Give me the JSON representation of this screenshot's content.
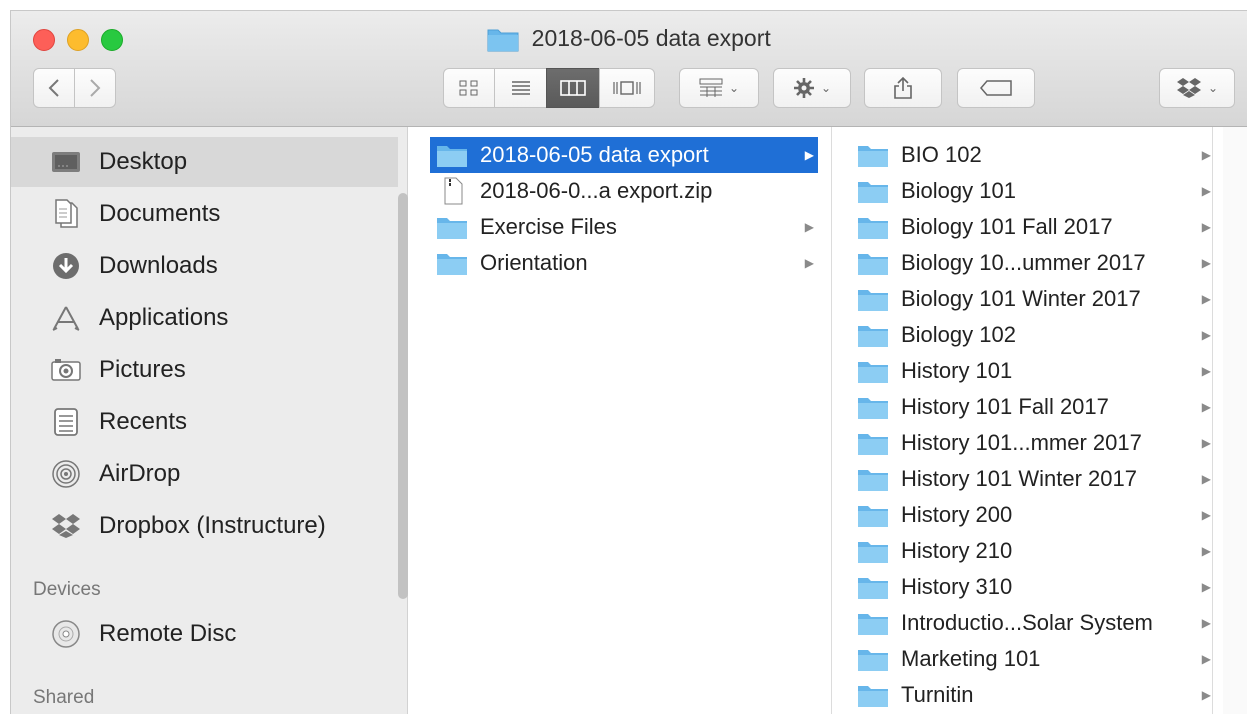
{
  "window": {
    "title": "2018-06-05 data export"
  },
  "toolbar": {
    "back_icon": "chevron-left-icon",
    "forward_icon": "chevron-right-icon",
    "view_buttons": [
      "icon-view-icon",
      "list-view-icon",
      "column-view-icon",
      "cover-flow-icon"
    ],
    "active_view": "column-view",
    "arrange_icon": "arrange-grid-icon",
    "action_icon": "gear-icon",
    "share_icon": "share-icon",
    "tag_icon": "tag-icon",
    "dropbox_icon": "dropbox-icon",
    "caret": "⌄"
  },
  "sidebar": {
    "favorites": [
      {
        "label": "Desktop",
        "icon": "desktop-icon",
        "selected": true
      },
      {
        "label": "Documents",
        "icon": "documents-icon"
      },
      {
        "label": "Downloads",
        "icon": "downloads-icon"
      },
      {
        "label": "Applications",
        "icon": "applications-icon"
      },
      {
        "label": "Pictures",
        "icon": "pictures-icon"
      },
      {
        "label": "Recents",
        "icon": "recents-icon"
      },
      {
        "label": "AirDrop",
        "icon": "airdrop-icon"
      },
      {
        "label": "Dropbox (Instructure)",
        "icon": "dropbox-icon"
      }
    ],
    "devices_header": "Devices",
    "devices": [
      {
        "label": "Remote Disc",
        "icon": "disc-icon"
      }
    ],
    "shared_header": "Shared"
  },
  "columns": {
    "first": [
      {
        "label": "2018-06-05 data export",
        "type": "folder",
        "has_children": true,
        "selected": true
      },
      {
        "label": "2018-06-0...a export.zip",
        "type": "zip",
        "has_children": false
      },
      {
        "label": "Exercise Files",
        "type": "folder",
        "has_children": true
      },
      {
        "label": "Orientation",
        "type": "folder",
        "has_children": true
      }
    ],
    "second": [
      {
        "label": "BIO 102"
      },
      {
        "label": "Biology 101"
      },
      {
        "label": "Biology 101 Fall 2017"
      },
      {
        "label": "Biology 10...ummer 2017"
      },
      {
        "label": "Biology 101 Winter 2017"
      },
      {
        "label": "Biology 102"
      },
      {
        "label": "History 101"
      },
      {
        "label": "History 101 Fall 2017"
      },
      {
        "label": "History 101...mmer 2017"
      },
      {
        "label": "History 101 Winter 2017"
      },
      {
        "label": "History 200"
      },
      {
        "label": "History 210"
      },
      {
        "label": "History 310"
      },
      {
        "label": "Introductio...Solar System"
      },
      {
        "label": "Marketing 101"
      },
      {
        "label": "Turnitin"
      }
    ]
  },
  "colors": {
    "selection": "#1f6fd6",
    "folder_blue": "#67b6ea",
    "sidebar_bg": "#ececec"
  }
}
